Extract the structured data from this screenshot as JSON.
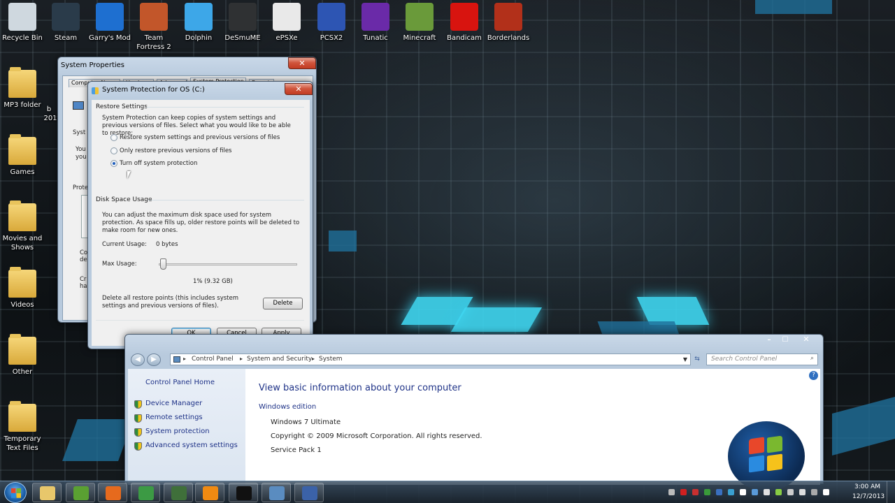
{
  "desktop": {
    "top_icons": [
      {
        "label": "Recycle Bin",
        "icon": "recycle-bin-icon",
        "color": "#cfd8df"
      },
      {
        "label": "Steam",
        "icon": "steam-icon",
        "color": "#2a3b4a"
      },
      {
        "label": "Garry's Mod",
        "icon": "garrys-mod-icon",
        "color": "#1e6fd0"
      },
      {
        "label": "Team Fortress 2",
        "icon": "team-fortress-2-icon",
        "color": "#c2562a"
      },
      {
        "label": "Dolphin",
        "icon": "dolphin-icon",
        "color": "#3da7e8"
      },
      {
        "label": "DeSmuME",
        "icon": "desmume-icon",
        "color": "#2f3133"
      },
      {
        "label": "ePSXe",
        "icon": "epsxe-icon",
        "color": "#e9e9e9"
      },
      {
        "label": "PCSX2",
        "icon": "pcsx2-icon",
        "color": "#2d55b3"
      },
      {
        "label": "Tunatic",
        "icon": "tunatic-icon",
        "color": "#6a2aa8"
      },
      {
        "label": "Minecraft",
        "icon": "minecraft-icon",
        "color": "#6a9a3a"
      },
      {
        "label": "Bandicam",
        "icon": "bandicam-icon",
        "color": "#d8140f"
      },
      {
        "label": "Borderlands",
        "icon": "borderlands-icon",
        "color": "#b2301a"
      }
    ],
    "left_icons": [
      {
        "label": "MP3 folder"
      },
      {
        "label": "Games"
      },
      {
        "label": "Movies and Shows"
      },
      {
        "label": "Videos"
      },
      {
        "label": "Other"
      },
      {
        "label": "Temporary Text Files"
      }
    ],
    "partial_label_b": "b",
    "partial_label_201": "201"
  },
  "system_properties": {
    "title": "System Properties",
    "tabs": [
      "Computer Name",
      "Hardware",
      "Advanced",
      "System Protection",
      "Remote"
    ],
    "partial": {
      "syst": "Syst",
      "you1": "You",
      "you2": "you",
      "prote": "Prote",
      "co": "Co",
      "de": "de",
      "cr": "Cr",
      "ha": "ha"
    }
  },
  "dialog": {
    "title": "System Protection for OS (C:)",
    "restore_settings": {
      "heading": "Restore Settings",
      "description": "System Protection can keep copies of system settings and previous versions of files. Select what you would like to be able to restore:",
      "options": [
        {
          "label": "Restore system settings and previous versions of files",
          "selected": false
        },
        {
          "label": "Only restore previous versions of files",
          "selected": false
        },
        {
          "label": "Turn off system protection",
          "selected": true
        }
      ]
    },
    "disk_space": {
      "heading": "Disk Space Usage",
      "description": "You can adjust the maximum disk space used for system protection. As space fills up, older restore points will be deleted to make room for new ones.",
      "current_usage_label": "Current Usage:",
      "current_usage_value": "0 bytes",
      "max_usage_label": "Max Usage:",
      "max_usage_fraction": 0.01,
      "max_usage_readout": "1% (9.32 GB)",
      "delete_text": "Delete all restore points (this includes system settings and previous versions of files).",
      "delete_button": "Delete"
    },
    "buttons": {
      "ok": "OK",
      "cancel": "Cancel",
      "apply": "Apply"
    }
  },
  "explorer": {
    "breadcrumb": [
      "Control Panel",
      "System and Security",
      "System"
    ],
    "search_placeholder": "Search Control Panel",
    "sidebar_home": "Control Panel Home",
    "sidebar_links": [
      "Device Manager",
      "Remote settings",
      "System protection",
      "Advanced system settings"
    ],
    "main_title": "View basic information about your computer",
    "section": "Windows edition",
    "edition": "Windows 7 Ultimate",
    "copyright": "Copyright © 2009 Microsoft Corporation.  All rights reserved.",
    "service_pack": "Service Pack 1"
  },
  "taskbar": {
    "pinned": [
      {
        "icon": "explorer-folder-icon",
        "color": "#e8c76b"
      },
      {
        "icon": "utorrent-icon",
        "color": "#5aa032"
      },
      {
        "icon": "firefox-icon",
        "color": "#e66a1d"
      },
      {
        "icon": "chrome-icon",
        "color": "#3c9a44"
      },
      {
        "icon": "monitor-icon",
        "color": "#3f6f3a"
      },
      {
        "icon": "vlc-icon",
        "color": "#f08a12"
      },
      {
        "icon": "cmd-icon",
        "color": "#111111"
      },
      {
        "icon": "control-panel-icon",
        "color": "#5a8cc0"
      },
      {
        "icon": "system-properties-icon",
        "color": "#3b62a8"
      }
    ],
    "clock_time": "3:00 AM",
    "clock_date": "12/7/2013"
  }
}
